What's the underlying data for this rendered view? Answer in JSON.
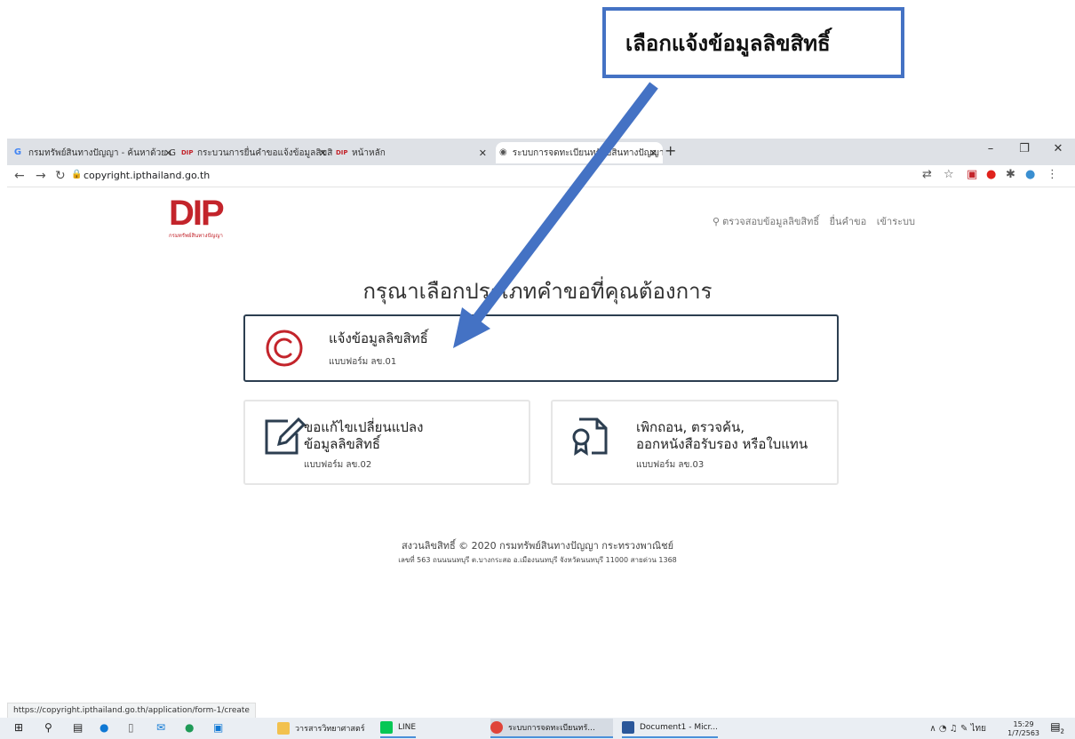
{
  "callout": {
    "text": "เลือกแจ้งข้อมูลลิขสิทธิ์"
  },
  "browser": {
    "tabs": [
      {
        "favicon": "G",
        "label": "กรมทรัพย์สินทางปัญญา - ค้นหาด้วย G"
      },
      {
        "favicon": "DIP",
        "label": "กระบวนการยื่นคำขอแจ้งข้อมูลลิขสิทธิ์"
      },
      {
        "favicon": "DIP",
        "label": "หน้าหลัก"
      },
      {
        "favicon": "globe-icon",
        "label": "ระบบการจดทะเบียนทรัพย์สินทางปัญญา"
      }
    ],
    "new_tab": "+",
    "url": "copyright.ipthailand.go.th"
  },
  "site": {
    "logo_text": "DIP",
    "logo_sub": "กรมทรัพย์สินทางปัญญา",
    "nav": {
      "search_label": "ตรวจสอบข้อมูลลิขสิทธิ์",
      "submit_label": "ยื่นคำขอ",
      "login_label": "เข้าระบบ"
    },
    "heading": "กรุณาเลือกประเภทคำขอที่คุณต้องการ",
    "cards": [
      {
        "icon": "copyright-icon",
        "title": "แจ้งข้อมูลลิขสิทธิ์",
        "form": "แบบฟอร์ม ลข.01"
      },
      {
        "icon": "edit-icon",
        "title_line1": "ขอแก้ไขเปลี่ยนแปลง",
        "title_line2": "ข้อมูลลิขสิทธิ์",
        "form": "แบบฟอร์ม ลข.02"
      },
      {
        "icon": "certificate-document-icon",
        "title_line1": "เพิกถอน, ตรวจค้น,",
        "title_line2": "ออกหนังสือรับรอง หรือใบแทน",
        "form": "แบบฟอร์ม ลข.03"
      }
    ],
    "footer_line1": "สงวนลิขสิทธิ์ © 2020 กรมทรัพย์สินทางปัญญา กระทรวงพาณิชย์",
    "footer_line2": "เลขที่ 563 ถนนนนทบุรี ต.บางกระสอ อ.เมืองนนทบุรี จังหวัดนนทบุรี 11000 สายด่วน 1368"
  },
  "status_url": "https://copyright.ipthailand.go.th/application/form-1/create",
  "taskbar": {
    "items": [
      {
        "label": "วารสารวิทยาศาสตร์"
      },
      {
        "label": "LINE"
      },
      {
        "label": "ระบบการจดทะเบียนทรั..."
      },
      {
        "label": "Document1 - Micr..."
      }
    ],
    "lang": "ไทย",
    "time": "15:29",
    "date": "1/7/2563",
    "notif_count": "2"
  }
}
